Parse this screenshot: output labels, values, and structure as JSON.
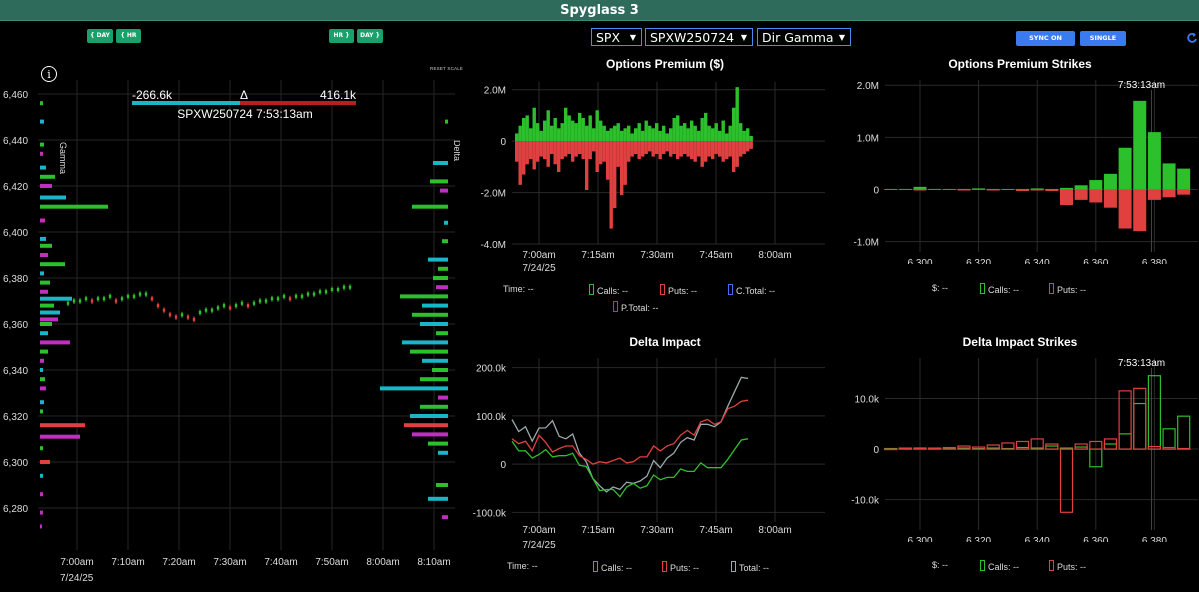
{
  "app": {
    "title": "Spyglass 3"
  },
  "left_buttons": [
    "{ DAY",
    "{ HR",
    "HR }",
    "DAY }"
  ],
  "selectors": {
    "symbol": "SPX",
    "contract": "SPXW250724",
    "mode": "Dir Gamma"
  },
  "sync_buttons": [
    "SYNC ON",
    "SINGLE"
  ],
  "colors": {
    "calls": "#2cc02c",
    "puts": "#e04040",
    "cyan": "#19b5c8",
    "magenta": "#c030c0",
    "total": "#9aa",
    "button_blue": "#3a7bf0",
    "button_green": "#1aa06a"
  },
  "main_chart": {
    "info_icon": "info-icon",
    "reset_scale": "RESET SCALE",
    "left_value": "-266.6k",
    "delta_symbol": "Δ",
    "right_value": "416.1k",
    "subtitle": "SPXW250724 7:53:13am",
    "left_axis_label": "Gamma",
    "right_axis_label": "Delta",
    "y_ticks": [
      "6,460",
      "6,440",
      "6,420",
      "6,400",
      "6,380",
      "6,360",
      "6,340",
      "6,320",
      "6,300",
      "6,280"
    ],
    "x_ticks": [
      "7:00am",
      "7:10am",
      "7:20am",
      "7:30am",
      "7:40am",
      "7:50am",
      "8:00am",
      "8:10am"
    ],
    "x_date": "7/24/25"
  },
  "chart_data": [
    {
      "id": "options_premium",
      "type": "bar",
      "title": "Options Premium ($)",
      "y_ticks": [
        "2.0M",
        "0",
        "-2.0M",
        "-4.0M"
      ],
      "ylim": [
        -4.0,
        2.0
      ],
      "x_ticks": [
        "7:00am",
        "7:15am",
        "7:30am",
        "7:45am",
        "8:00am"
      ],
      "x_date": "7/24/25",
      "series": [
        {
          "name": "Calls",
          "values": [
            0.3,
            0.6,
            0.9,
            1.0,
            0.5,
            1.3,
            0.7,
            0.4,
            0.8,
            1.2,
            0.6,
            0.9,
            0.5,
            0.7,
            1.3,
            1.0,
            0.8,
            0.7,
            1.1,
            0.9,
            0.6,
            1.0,
            0.5,
            1.2,
            0.8,
            0.6,
            0.4,
            0.5,
            0.6,
            0.7,
            0.4,
            0.5,
            0.6,
            0.3,
            0.5,
            0.7,
            0.4,
            0.8,
            0.6,
            0.5,
            0.7,
            0.4,
            0.6,
            0.3,
            0.5,
            0.9,
            1.0,
            0.6,
            0.7,
            0.5,
            0.8,
            0.6,
            0.4,
            0.9,
            1.1,
            0.6,
            0.5,
            0.7,
            0.4,
            0.8,
            0.3,
            0.6,
            1.3,
            2.1,
            0.7,
            0.4,
            0.5,
            0.2
          ]
        },
        {
          "name": "Puts",
          "values": [
            -0.8,
            -1.7,
            -1.3,
            -0.9,
            -0.7,
            -1.1,
            -0.8,
            -0.6,
            -0.7,
            -1.0,
            -0.5,
            -0.9,
            -1.2,
            -0.7,
            -0.6,
            -0.5,
            -0.8,
            -0.6,
            -0.5,
            -0.7,
            -1.9,
            -0.7,
            -0.4,
            -1.2,
            -0.9,
            -0.8,
            -1.5,
            -3.4,
            -2.6,
            -1.0,
            -2.1,
            -1.7,
            -0.8,
            -0.6,
            -0.5,
            -0.7,
            -0.6,
            -0.5,
            -0.4,
            -0.6,
            -0.5,
            -0.7,
            -0.5,
            -0.4,
            -0.6,
            -0.5,
            -0.7,
            -0.6,
            -0.5,
            -0.6,
            -0.7,
            -0.8,
            -0.6,
            -1.0,
            -0.8,
            -0.6,
            -0.7,
            -0.5,
            -0.6,
            -0.8,
            -0.7,
            -0.6,
            -1.2,
            -1.0,
            -0.6,
            -0.5,
            -0.4,
            -0.3
          ]
        }
      ],
      "legend": [
        {
          "label": "Time:",
          "value": "--"
        },
        {
          "label": "Calls:",
          "value": "--"
        },
        {
          "label": "Puts:",
          "value": "--"
        },
        {
          "label": "C.Total:",
          "value": "--"
        },
        {
          "label": "P.Total:",
          "value": "--"
        }
      ]
    },
    {
      "id": "options_premium_strikes",
      "type": "bar",
      "title": "Options Premium Strikes",
      "timestamp": "7:53:13am",
      "y_ticks": [
        "2.0M",
        "1.0M",
        "0",
        "-1.0M"
      ],
      "ylim": [
        -1.2,
        2.0
      ],
      "x_ticks": [
        "6,300",
        "6,320",
        "6,340",
        "6,360",
        "6,380"
      ],
      "strikes": [
        6290,
        6295,
        6300,
        6305,
        6310,
        6315,
        6320,
        6325,
        6330,
        6335,
        6340,
        6345,
        6350,
        6355,
        6360,
        6365,
        6370,
        6375,
        6380,
        6385,
        6390
      ],
      "series": [
        {
          "name": "Calls",
          "values": [
            0.01,
            0.01,
            0.05,
            0.01,
            0.01,
            0.01,
            0.02,
            0.01,
            0.01,
            0.01,
            0.02,
            0.01,
            0.03,
            0.08,
            0.18,
            0.3,
            0.8,
            1.7,
            1.1,
            0.5,
            0.4
          ]
        },
        {
          "name": "Puts",
          "values": [
            -0.01,
            -0.01,
            -0.02,
            -0.01,
            -0.01,
            -0.02,
            -0.01,
            -0.02,
            -0.01,
            -0.03,
            -0.02,
            -0.03,
            -0.3,
            -0.2,
            -0.25,
            -0.35,
            -0.75,
            -0.8,
            -0.2,
            -0.15,
            -0.1
          ]
        }
      ],
      "legend": [
        {
          "label": "$:",
          "value": "--"
        },
        {
          "label": "Calls:",
          "value": "--"
        },
        {
          "label": "Puts:",
          "value": "--"
        }
      ]
    },
    {
      "id": "delta_impact",
      "type": "line",
      "title": "Delta Impact",
      "y_ticks": [
        "200.0k",
        "100.0k",
        "0",
        "-100.0k"
      ],
      "ylim": [
        -120,
        220
      ],
      "x_ticks": [
        "7:00am",
        "7:15am",
        "7:30am",
        "7:45am",
        "8:00am"
      ],
      "x_date": "7/24/25",
      "series": [
        {
          "name": "Calls",
          "values": [
            40,
            25,
            30,
            20,
            15,
            30,
            20,
            10,
            15,
            25,
            5,
            -10,
            -30,
            -50,
            -60,
            -55,
            -65,
            -40,
            -45,
            -50,
            -40,
            -30,
            -35,
            -25,
            -20,
            -15,
            -15,
            -10,
            -5,
            -10,
            -5,
            0,
            5,
            30,
            55,
            45
          ]
        },
        {
          "name": "Puts",
          "values": [
            45,
            40,
            50,
            35,
            55,
            45,
            30,
            25,
            35,
            40,
            25,
            5,
            0,
            10,
            -5,
            5,
            15,
            10,
            0,
            15,
            20,
            30,
            25,
            40,
            50,
            55,
            70,
            65,
            80,
            90,
            85,
            95,
            110,
            120,
            135,
            125
          ]
        },
        {
          "name": "Total",
          "values": [
            85,
            65,
            80,
            55,
            70,
            75,
            95,
            50,
            50,
            65,
            30,
            0,
            -30,
            -40,
            -65,
            -50,
            -50,
            -30,
            -45,
            -35,
            -20,
            0,
            -10,
            15,
            30,
            40,
            55,
            55,
            75,
            80,
            80,
            95,
            115,
            150,
            185,
            170
          ]
        }
      ],
      "legend": [
        {
          "label": "Time:",
          "value": "--"
        },
        {
          "label": "Calls:",
          "value": "--"
        },
        {
          "label": "Puts:",
          "value": "--"
        },
        {
          "label": "Total:",
          "value": "--"
        }
      ]
    },
    {
      "id": "delta_impact_strikes",
      "type": "bar",
      "title": "Delta Impact Strikes",
      "timestamp": "7:53:13am",
      "y_ticks": [
        "10.0k",
        "0",
        "-10.0k"
      ],
      "ylim": [
        -16,
        18
      ],
      "x_ticks": [
        "6,300",
        "6,320",
        "6,340",
        "6,360",
        "6,380"
      ],
      "strikes": [
        6290,
        6295,
        6300,
        6305,
        6310,
        6315,
        6320,
        6325,
        6330,
        6335,
        6340,
        6345,
        6350,
        6355,
        6360,
        6365,
        6370,
        6375,
        6380,
        6385,
        6390
      ],
      "series": [
        {
          "name": "Calls",
          "values": [
            0.1,
            0.1,
            0.2,
            0.1,
            0.1,
            0.2,
            0.1,
            0.2,
            0.1,
            0.3,
            0.2,
            0.6,
            0.2,
            0.4,
            -3.5,
            1,
            3,
            9,
            14.5,
            4,
            6.5
          ]
        },
        {
          "name": "Puts",
          "values": [
            -0.1,
            0.2,
            0.1,
            0.2,
            0.3,
            0.6,
            0.4,
            0.8,
            1.2,
            1.5,
            2,
            1,
            -12.5,
            1,
            1.5,
            2,
            11.5,
            12,
            0.5,
            0.3,
            0.1
          ]
        }
      ],
      "legend": [
        {
          "label": "$:",
          "value": "--"
        },
        {
          "label": "Calls:",
          "value": "--"
        },
        {
          "label": "Puts:",
          "value": "--"
        }
      ]
    }
  ]
}
